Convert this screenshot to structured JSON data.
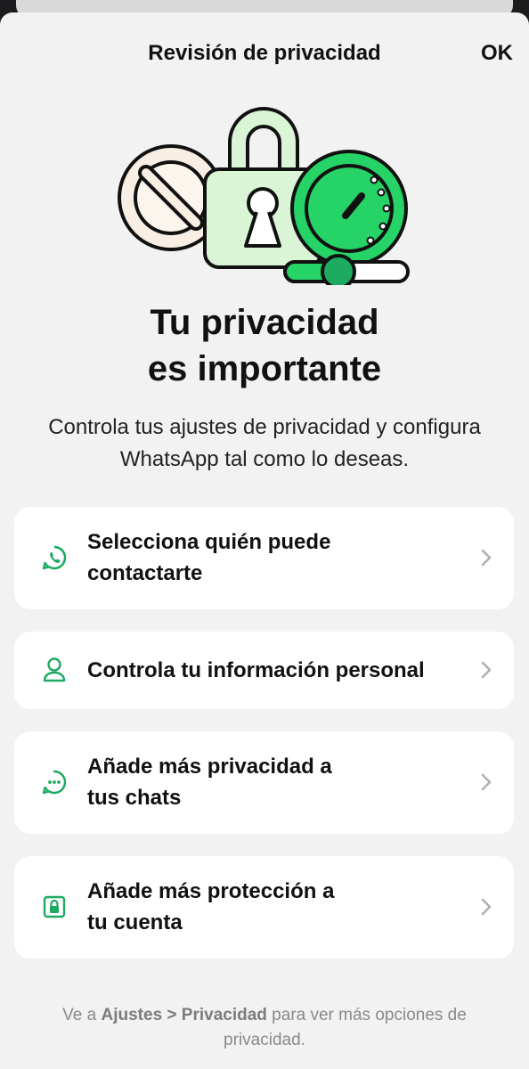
{
  "header": {
    "title": "Revisión de privacidad",
    "ok_label": "OK"
  },
  "hero": {
    "headline_line1": "Tu privacidad",
    "headline_line2": "es importante",
    "description": "Controla tus ajustes de privacidad y configura WhatsApp tal como lo deseas."
  },
  "options": [
    {
      "icon": "chat-phone-icon",
      "line1": "Selecciona quién puede",
      "line2": "contactarte"
    },
    {
      "icon": "person-icon",
      "line1": "Controla tu información personal",
      "line2": ""
    },
    {
      "icon": "chat-dots-icon",
      "line1": "Añade más privacidad a",
      "line2": "tus chats"
    },
    {
      "icon": "lock-icon",
      "line1": "Añade más protección a",
      "line2": "tu cuenta"
    }
  ],
  "footer": {
    "prefix": "Ve a ",
    "path_settings": "Ajustes",
    "separator": " > ",
    "path_privacy": "Privacidad",
    "suffix": " para ver más opciones de privacidad."
  },
  "colors": {
    "accent": "#1DAA61",
    "accent_light": "#25D366",
    "sheet_background": "#F2F2F2",
    "card_background": "#FFFFFF"
  }
}
